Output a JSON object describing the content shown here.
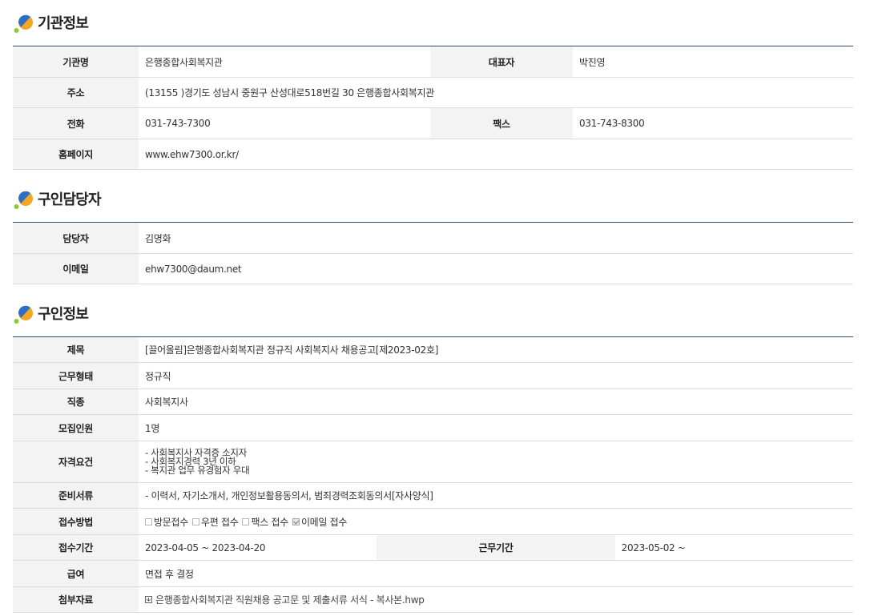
{
  "sections": {
    "org": {
      "title": "기관정보",
      "rows": {
        "name_label": "기관명",
        "name_value": "은행종합사회복지관",
        "rep_label": "대표자",
        "rep_value": "박진영",
        "addr_label": "주소",
        "addr_value": "(13155 )경기도 성남시 중원구 산성대로518번길 30 은행종합사회복지관",
        "phone_label": "전화",
        "phone_value": "031-743-7300",
        "fax_label": "팩스",
        "fax_value": "031-743-8300",
        "homepage_label": "홈페이지",
        "homepage_value": "www.ehw7300.or.kr/"
      }
    },
    "contact": {
      "title": "구인담당자",
      "rows": {
        "person_label": "담당자",
        "person_value": "김명화",
        "email_label": "이메일",
        "email_value": "ehw7300@daum.net"
      }
    },
    "job": {
      "title": "구인정보",
      "rows": {
        "subject_label": "제목",
        "subject_value": "[끌어올림]은행종합사회복지관 정규직 사회복지사 채용공고[제2023-02호]",
        "type_label": "근무형태",
        "type_value": "정규직",
        "category_label": "직종",
        "category_value": "사회복지사",
        "count_label": "모집인원",
        "count_value": "1명",
        "req_label": "자격요건",
        "req_lines": [
          "- 사회복지사 자격증 소지자",
          "- 사회복지경력 3년 이하",
          "- 복지관 업무 유경험자 우대"
        ],
        "docs_label": "준비서류",
        "docs_value": "- 이력서, 자기소개서, 개인정보활용동의서, 범죄경력조회동의서[자사양식]",
        "method_label": "접수방법",
        "methods": [
          {
            "label": "방문접수",
            "checked": false
          },
          {
            "label": "우편 접수",
            "checked": false
          },
          {
            "label": "팩스 접수",
            "checked": false
          },
          {
            "label": "이메일 접수",
            "checked": true
          }
        ],
        "period_label": "접수기간",
        "period_value": "2023-04-05 ~ 2023-04-20",
        "work_period_label": "근무기간",
        "work_period_value": "2023-05-02 ~",
        "salary_label": "급여",
        "salary_value": "면접 후 결정",
        "attach_label": "첨부자료",
        "attach_value": "은행종합사회복지관 직원채용 공고문 및 제출서류 서식 - 복사본.hwp"
      }
    }
  },
  "colors": {
    "header_border": "#2f4a6b",
    "label_bg": "#f3f3f3",
    "icon_blue": "#2b6fc7",
    "icon_orange": "#f5a623",
    "icon_green": "#8cc63f"
  },
  "icons": {
    "section_icon": "section-logo-icon",
    "attachment_icon": "file-attachment-icon"
  }
}
